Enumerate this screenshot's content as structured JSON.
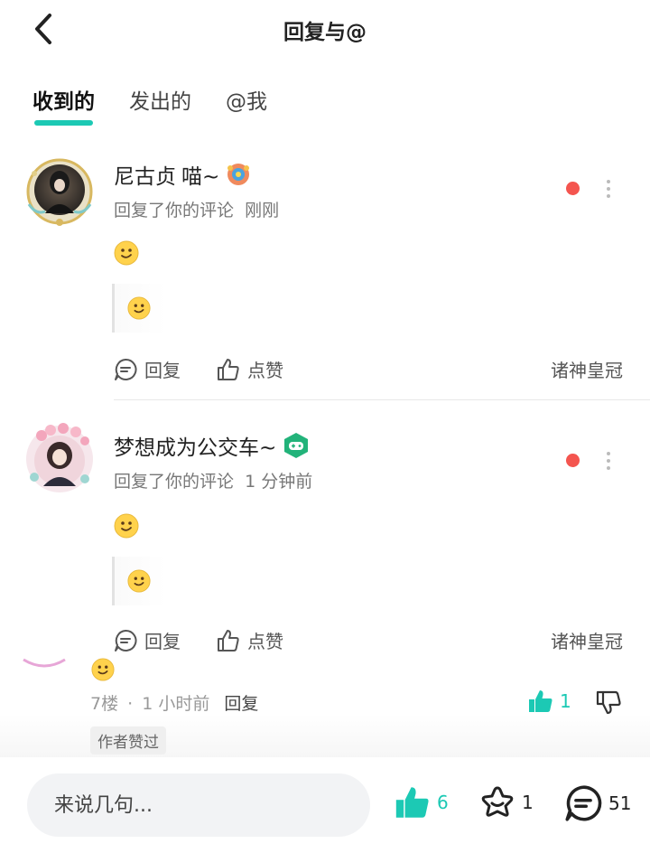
{
  "header": {
    "title": "回复与@"
  },
  "tabs": [
    {
      "label": "收到的",
      "active": true
    },
    {
      "label": "发出的",
      "active": false
    },
    {
      "label": "@我",
      "active": false
    }
  ],
  "notifications": [
    {
      "username": "尼古贞",
      "username_suffix": "喵~",
      "action_text": "回复了你的评论",
      "time": "刚刚",
      "reply_label": "回复",
      "like_label": "点赞",
      "source": "诸神皇冠",
      "unread": true
    },
    {
      "username": "梦想成为公交车~",
      "username_suffix": "",
      "action_text": "回复了你的评论",
      "time": "1 分钟前",
      "reply_label": "回复",
      "like_label": "点赞",
      "source": "诸神皇冠",
      "unread": true
    }
  ],
  "underlying_comment": {
    "floor": "7楼",
    "separator": "·",
    "time": "1 小时前",
    "reply_label": "回复",
    "like_count": "1",
    "author_liked": "作者赞过"
  },
  "bottom_bar": {
    "input_placeholder": "来说几句...",
    "likes": "6",
    "favorites": "1",
    "comments": "51"
  },
  "colors": {
    "accent": "#1cc9b4",
    "unread_dot": "#f4554f",
    "text_secondary": "#777777"
  },
  "icons": [
    "back-icon",
    "emoji-smile-icon",
    "comment-bubble-icon",
    "thumbs-up-icon",
    "thumbs-down-icon",
    "star-icon",
    "more-icon",
    "gamepad-badge-icon",
    "flower-badge-icon"
  ]
}
